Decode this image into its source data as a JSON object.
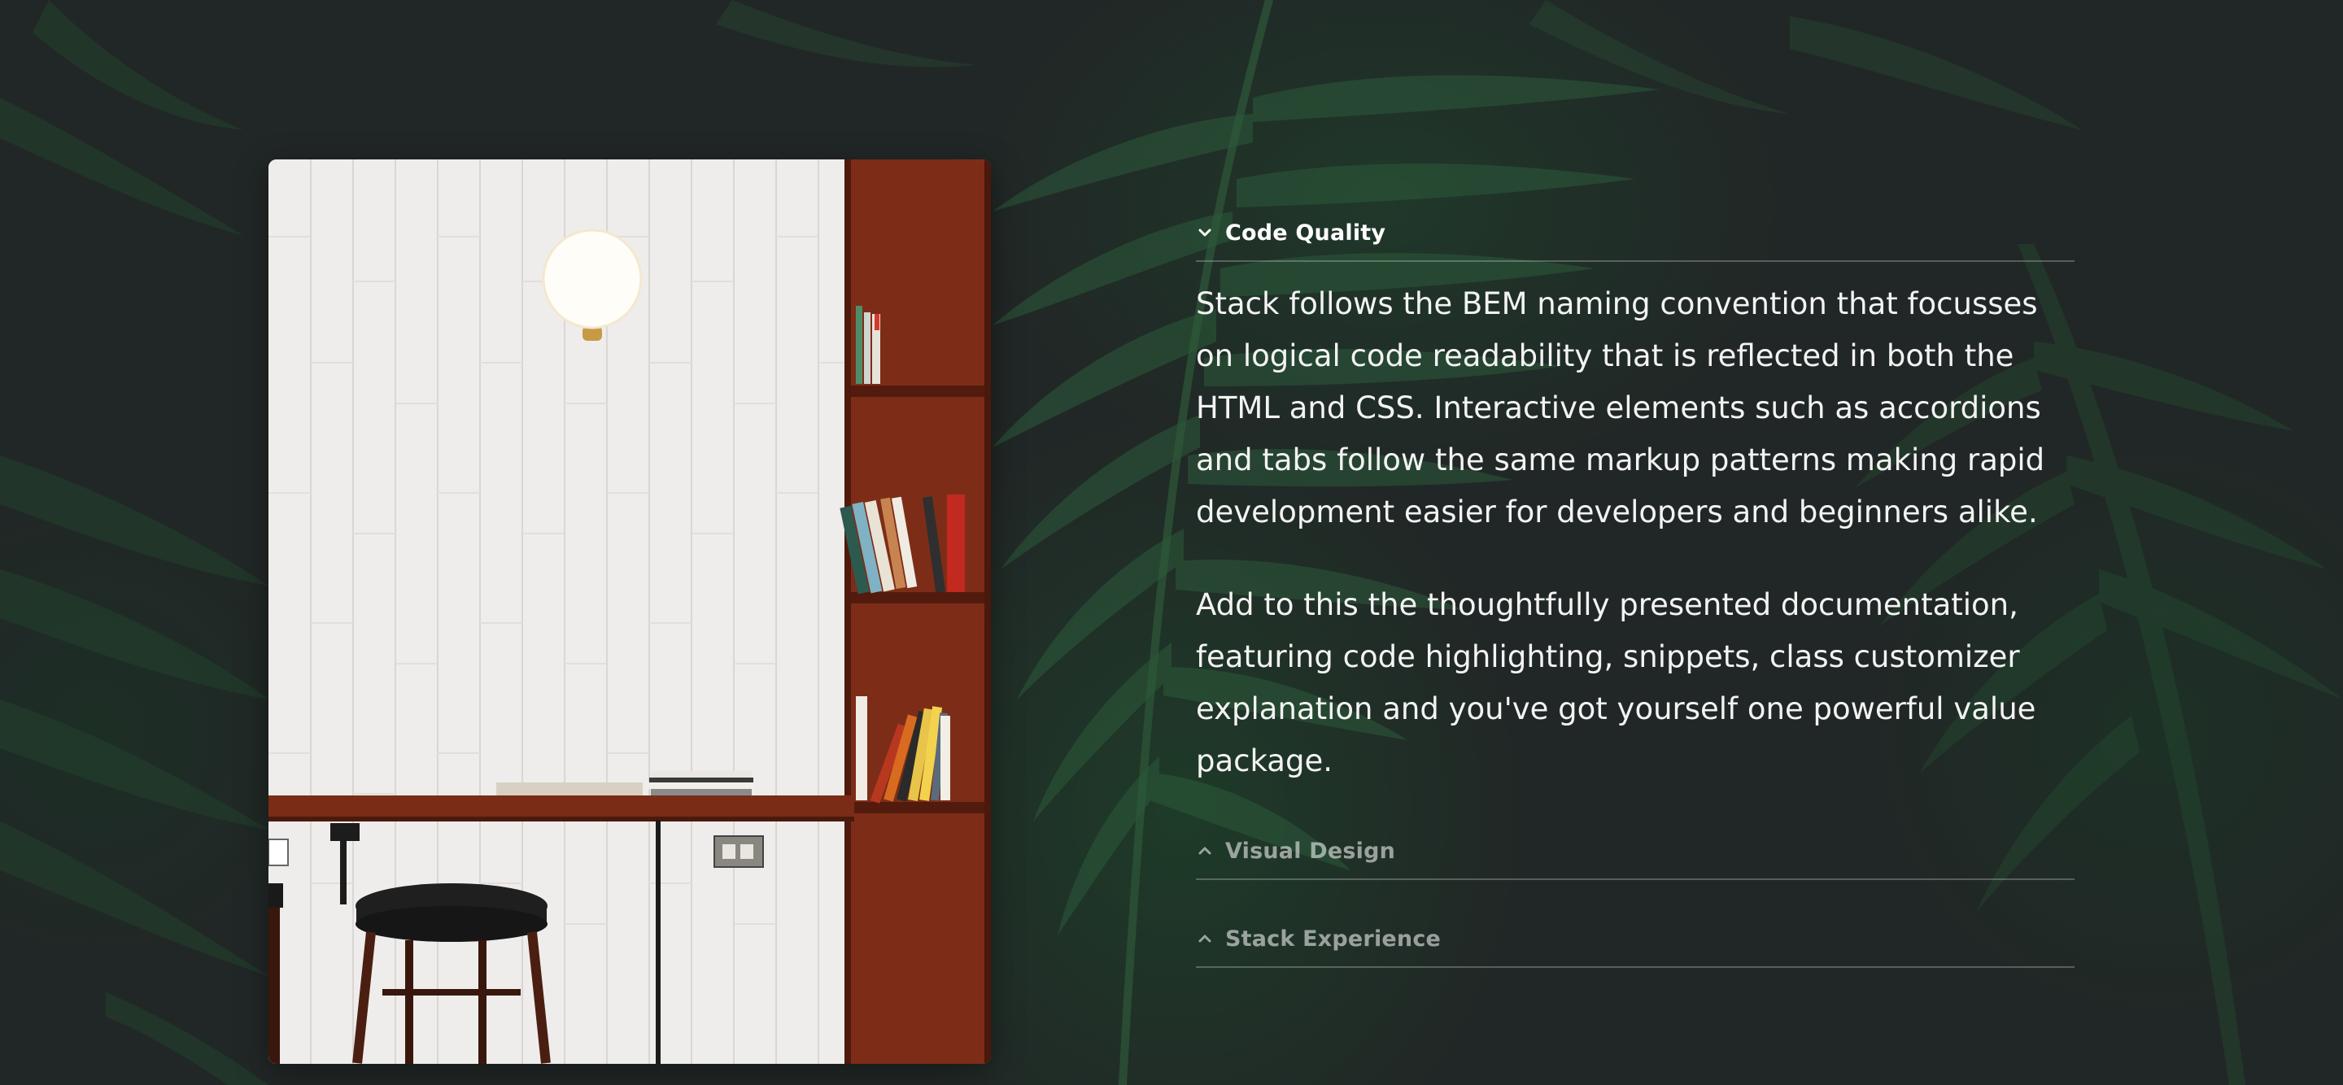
{
  "colors": {
    "background": "#212726",
    "text": "#f3f3f3",
    "muted_text": "rgba(255,255,255,0.55)",
    "divider": "rgba(255,255,255,0.25)",
    "leaf_green": "#2f5a3c",
    "shelf_wood": "#7a2a14"
  },
  "photo": {
    "icon": "cafe-interior-photo"
  },
  "accordion": {
    "items": [
      {
        "title": "Code Quality",
        "state": "expanded",
        "icon": "chevron-down-icon",
        "paragraphs": [
          "Stack follows the BEM naming convention that focusses on logical code readability that is reflected in both the HTML and CSS. Interactive elements such as accordions and tabs follow the same markup patterns making rapid development easier for developers and beginners alike.",
          "Add to this the thoughtfully presented documentation, featuring code highlighting, snippets, class customizer explanation and you've got yourself one powerful value package."
        ]
      },
      {
        "title": "Visual Design",
        "state": "collapsed",
        "icon": "chevron-up-icon"
      },
      {
        "title": "Stack Experience",
        "state": "collapsed",
        "icon": "chevron-up-icon"
      }
    ]
  }
}
